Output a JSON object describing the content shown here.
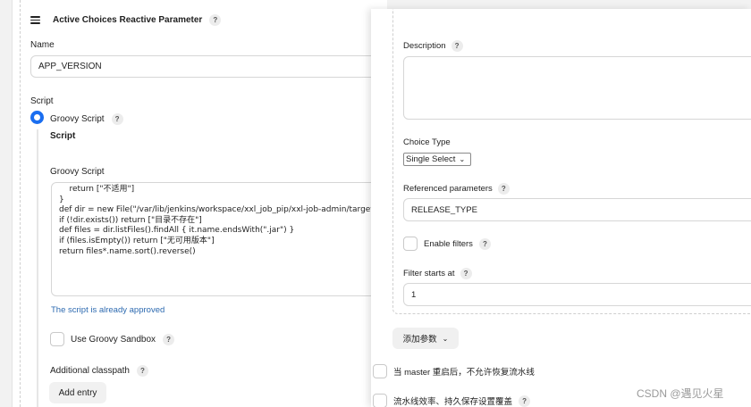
{
  "left": {
    "header_title": "Active Choices Reactive Parameter",
    "help_glyph": "?",
    "name_label": "Name",
    "name_value": "APP_VERSION",
    "script_label": "Script",
    "groovy_radio_label": "Groovy Script",
    "script_heading": "Script",
    "groovy_script_label": "Groovy Script",
    "code_lines": [
      "    return [\"不适用\"]",
      "}",
      "",
      "def dir = new File(\"/var/lib/jenkins/workspace/xxl_job_pip/xxl-job-admin/target\")",
      "if (!dir.exists()) return [\"目录不存在\"]",
      "def files = dir.listFiles().findAll { it.name.endsWith(\".jar\") }",
      "if (files.isEmpty()) return [\"无可用版本\"]",
      "",
      "return files*.name.sort().reverse()"
    ],
    "approved_text": "The script is already approved",
    "sandbox_label": "Use Groovy Sandbox",
    "classpath_label": "Additional classpath",
    "add_entry_label": "Add entry"
  },
  "right": {
    "description_label": "Description",
    "choice_type_label": "Choice Type",
    "choice_type_value": "Single Select",
    "referenced_label": "Referenced parameters",
    "referenced_value": "RELEASE_TYPE",
    "enable_filters_label": "Enable filters",
    "filter_starts_label": "Filter starts at",
    "filter_starts_value": "1",
    "add_param_label": "添加参数",
    "master_restart_label": "当 master 重启后，不允许恢复流水线",
    "pipeline_speed_label": "流水线效率、持久保存设置覆盖"
  },
  "watermark": "CSDN @遇见火星"
}
